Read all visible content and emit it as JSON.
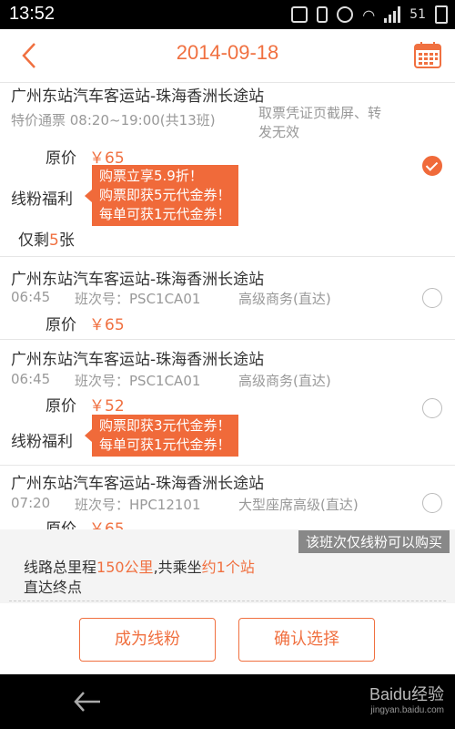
{
  "status_bar": {
    "time": "13:52",
    "battery": "51"
  },
  "header": {
    "title": "2014-09-18"
  },
  "tickets": [
    {
      "route": "广州东站汽车客运站-珠海香洲长途站",
      "meta_left": "特价通票  08:20~19:00(共13班)",
      "meta_right_1": "取票凭证页截屏、转",
      "meta_right_2": "发无效",
      "price_label": "原价",
      "price": "￥65",
      "fan_label": "线粉福利",
      "promos": [
        "购票立享5.9折！",
        "购票即获5元代金券！",
        "每单可获1元代金券！"
      ],
      "remain_prefix": "仅剩",
      "remain_num": "5",
      "remain_suffix": "张",
      "selected": true
    },
    {
      "route": "广州东站汽车客运站-珠海香洲长途站",
      "time": "06:45",
      "bus_no": "班次号：PSC1CA01",
      "bus_type": "高级商务(直达)",
      "price_label": "原价",
      "price": "￥65",
      "selected": false
    },
    {
      "route": "广州东站汽车客运站-珠海香洲长途站",
      "time": "06:45",
      "bus_no": "班次号：PSC1CA01",
      "bus_type": "高级商务(直达)",
      "price_label": "原价",
      "price": "￥52",
      "fan_label": "线粉福利",
      "promos": [
        "购票即获3元代金券！",
        "每单可获1元代金券！"
      ],
      "selected": false
    },
    {
      "route": "广州东站汽车客运站-珠海香洲长途站",
      "time": "07:20",
      "bus_no": "班次号：HPC12101",
      "bus_type": "大型座席高级(直达)",
      "price_label": "原价",
      "price": "￥65",
      "selected": false
    }
  ],
  "notice": "该班次仅线粉可以购买",
  "summary": {
    "mileage_prefix": "线路总里程",
    "mileage": "150公里",
    "ride_prefix": ",共乘坐",
    "duration": "约1个站",
    "line2": "直达终点"
  },
  "actions": {
    "fan_button": "成为线粉",
    "confirm_button": "确认选择"
  },
  "watermark": {
    "main": "Baidu经验",
    "sub": "jingyan.baidu.com"
  },
  "colors": {
    "accent": "#f07040"
  }
}
